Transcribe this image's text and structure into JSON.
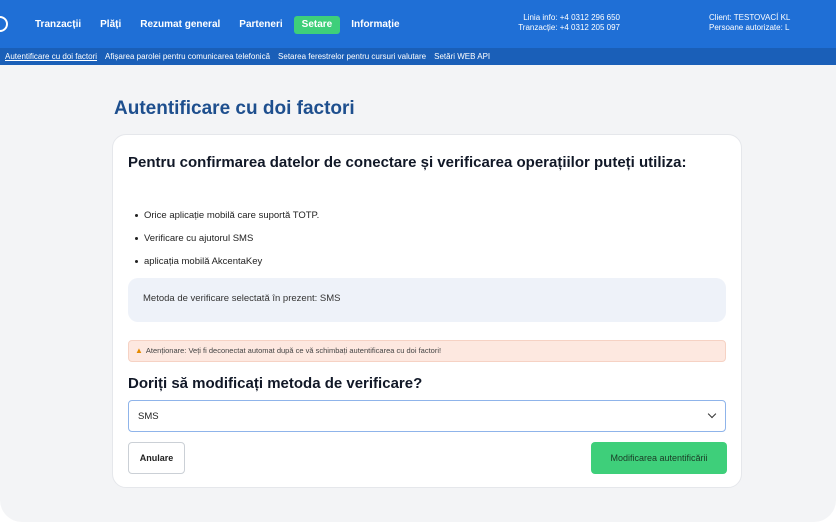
{
  "topbar": {
    "nav": [
      {
        "label": "Tranzacții",
        "active": false
      },
      {
        "label": "Plăți",
        "active": false
      },
      {
        "label": "Rezumat general",
        "active": false
      },
      {
        "label": "Parteneri",
        "active": false
      },
      {
        "label": "Setare",
        "active": true
      },
      {
        "label": "Informație",
        "active": false
      }
    ],
    "info_line": "Linia info: +4 0312 296 650",
    "tx_line": "Tranzacție: +4 0312 205 097",
    "client_line": "Client: TESTOVACÍ KL",
    "authorized_line": "Persoane autorizate: L",
    "active_color": "#3ecf7a",
    "bar_color": "#1f6fd6"
  },
  "subnav": [
    "Autentificare cu doi factori",
    "Afișarea parolei pentru comunicarea telefonică",
    "Setarea ferestrelor pentru cursuri valutare",
    "Setări WEB API"
  ],
  "page": {
    "title": "Autentificare cu doi factori",
    "lead": "Pentru confirmarea datelor de conectare și verificarea operațiilor puteți utiliza:",
    "features": [
      "Orice aplicație mobilă care suportă TOTP.",
      "Verificare cu ajutorul SMS",
      "aplicația mobilă AkcentaKey"
    ],
    "current_method": "Metoda de verificare selectată în prezent: SMS",
    "alert_text": "Atenționare: Veți fi deconectat automat după ce vă schimbați autentificarea cu doi factori!",
    "question": "Doriți să modificați metoda de verificare?",
    "select_value": "SMS",
    "cancel_label": "Anulare",
    "submit_label": "Modificarea autentificării"
  }
}
